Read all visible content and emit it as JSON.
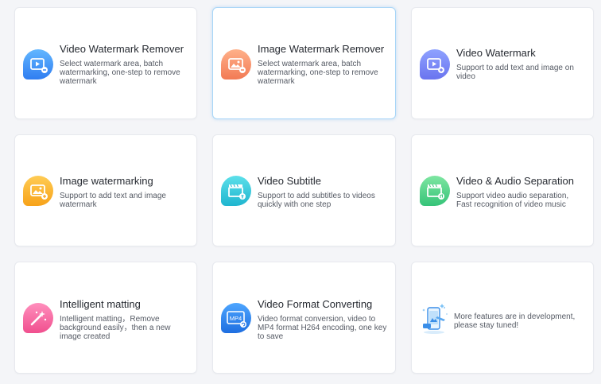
{
  "features": [
    {
      "title": "Video Watermark Remover",
      "desc": "Select watermark area, batch watermarking, one-step to remove watermark",
      "icon": "video-watermark-remover-icon",
      "color_top": "#63b7ff",
      "color_bottom": "#2f7df1"
    },
    {
      "title": "Image Watermark Remover",
      "desc": "Select watermark area, batch watermarking, one-step to remove watermark",
      "icon": "image-watermark-remover-icon",
      "color_top": "#ffb18a",
      "color_bottom": "#f27a55"
    },
    {
      "title": "Video Watermark",
      "desc": "Support to add text and image on video",
      "icon": "video-watermark-icon",
      "color_top": "#8fa2ff",
      "color_bottom": "#6a74ef"
    },
    {
      "title": "Image watermarking",
      "desc": "Support to add text and image watermark",
      "icon": "image-watermarking-icon",
      "color_top": "#ffcc55",
      "color_bottom": "#f7a219"
    },
    {
      "title": "Video Subtitle",
      "desc": "Support to add subtitles to videos quickly with one step",
      "icon": "video-subtitle-icon",
      "color_top": "#5de0ea",
      "color_bottom": "#1fb5cf"
    },
    {
      "title": "Video & Audio Separation",
      "desc": "Support video audio separation, Fast recognition of video music",
      "icon": "video-audio-separation-icon",
      "color_top": "#7fe6a2",
      "color_bottom": "#35c378"
    },
    {
      "title": "Intelligent matting",
      "desc": "Intelligent matting，Remove background easily，then a new image created",
      "icon": "magic-wand-icon",
      "color_top": "#ff8fbd",
      "color_bottom": "#f04f8e"
    },
    {
      "title": "Video Format Converting",
      "desc": "Video format conversion, video to MP4 format H264 encoding, one key to save",
      "icon": "mp4-convert-icon",
      "icon_text": "MP4",
      "color_top": "#4ea6ff",
      "color_bottom": "#1e6ee0"
    },
    {
      "coming_soon": "More features are in development, please stay tuned!",
      "icon": "phone-development-icon"
    }
  ]
}
